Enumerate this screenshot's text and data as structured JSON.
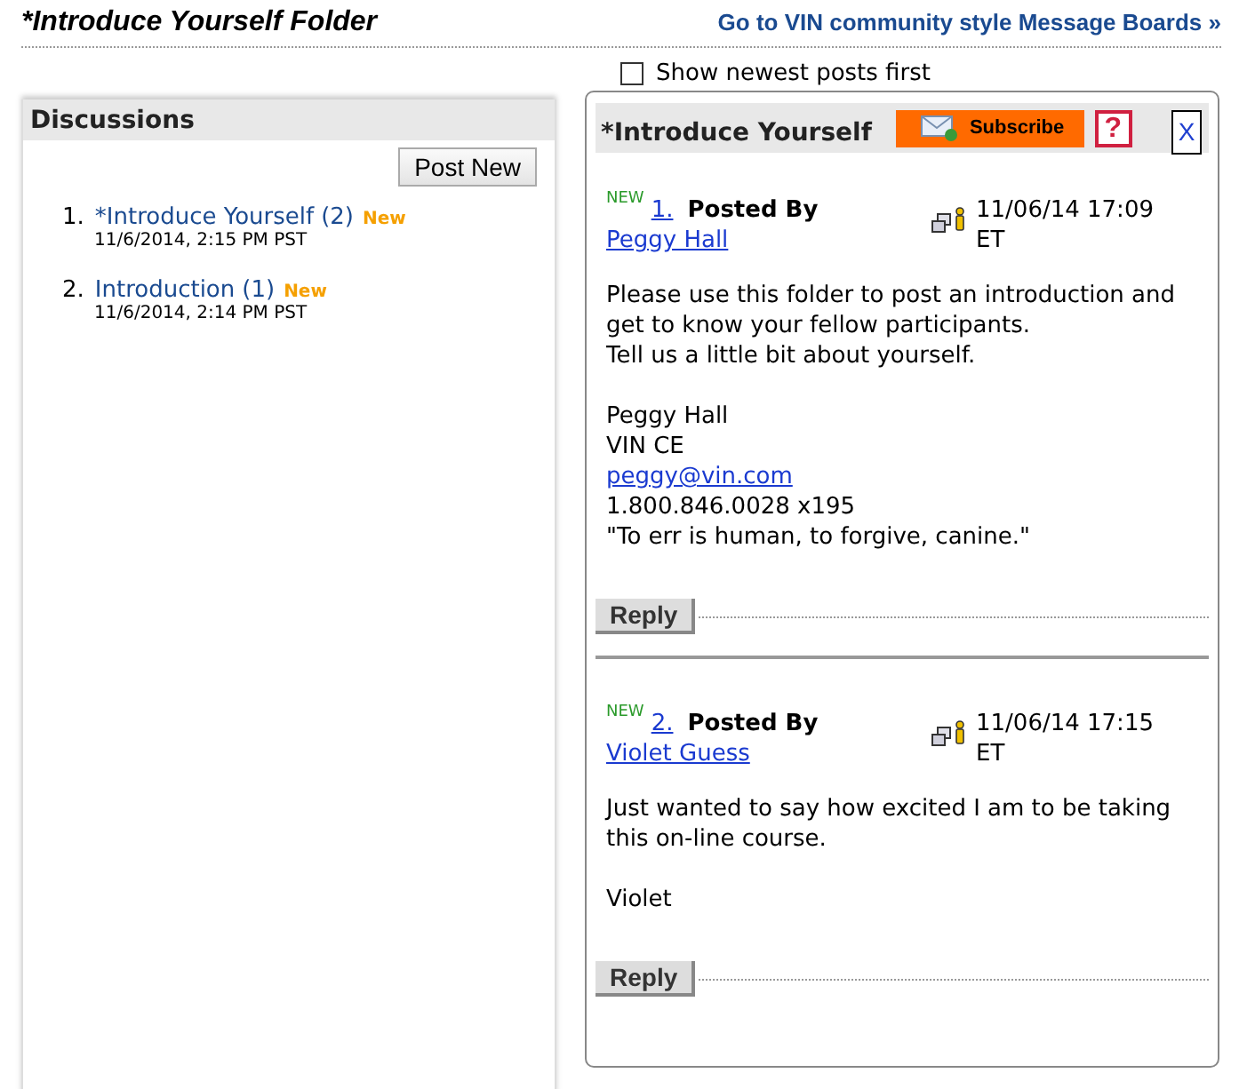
{
  "header": {
    "title": "*Introduce Yourself Folder",
    "link": "Go to VIN community style Message Boards »"
  },
  "discussions": {
    "title": "Discussions",
    "post_new": "Post New",
    "items": [
      {
        "number": "1.",
        "title": "*Introduce Yourself",
        "count": "(2)",
        "badge": "New",
        "date": "11/6/2014, 2:15 PM PST"
      },
      {
        "number": "2.",
        "title": "Introduction",
        "count": "(1)",
        "badge": "New",
        "date": "11/6/2014, 2:14 PM PST"
      }
    ]
  },
  "sort_option": {
    "label": "Show newest posts first",
    "checked": false
  },
  "thread": {
    "title": "*Introduce Yourself",
    "subscribe": "Subscribe",
    "help": "?",
    "close": "X",
    "posts": [
      {
        "new": "NEW",
        "number": "1.",
        "posted_by": "Posted By",
        "author": "Peggy Hall",
        "date": "11/06/14 17:09 ET",
        "paragraphs": [
          [
            {
              "kind": "text",
              "text": "Please use this folder to post an introduction and get to know your fellow participants."
            },
            {
              "kind": "text",
              "text": "Tell us a little bit about yourself."
            }
          ],
          [
            {
              "kind": "text",
              "text": "Peggy Hall"
            },
            {
              "kind": "text",
              "text": "VIN CE"
            },
            {
              "kind": "link",
              "text": "peggy@vin.com"
            },
            {
              "kind": "text",
              "text": "1.800.846.0028 x195"
            },
            {
              "kind": "text",
              "text": "\"To err is human, to forgive, canine.\""
            }
          ]
        ],
        "reply": "Reply"
      },
      {
        "new": "NEW",
        "number": "2.",
        "posted_by": "Posted By",
        "author": "Violet Guess",
        "date": "11/06/14 17:15 ET",
        "paragraphs": [
          [
            {
              "kind": "text",
              "text": "Just wanted to say how excited I am to be taking this on-line course."
            }
          ],
          [
            {
              "kind": "text",
              "text": "Violet"
            }
          ]
        ],
        "reply": "Reply"
      }
    ]
  }
}
